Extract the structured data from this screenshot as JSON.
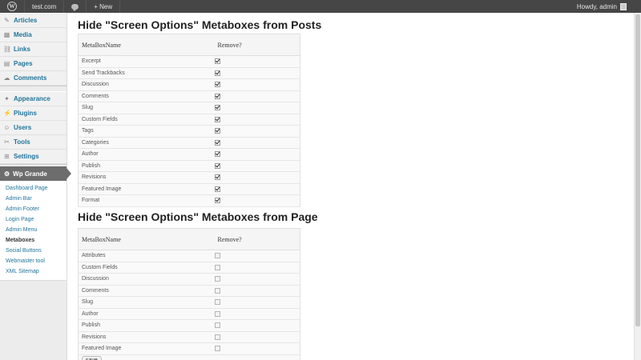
{
  "adminbar": {
    "logo": "W",
    "site": "test.com",
    "new_label": "+ New",
    "greeting": "Howdy, admin"
  },
  "sidebar": {
    "group1": [
      {
        "label": "Articles",
        "icon": "pin-icon",
        "glyph": "✎"
      },
      {
        "label": "Media",
        "icon": "media-icon",
        "glyph": "▦"
      },
      {
        "label": "Links",
        "icon": "link-icon",
        "glyph": "⛓"
      },
      {
        "label": "Pages",
        "icon": "pages-icon",
        "glyph": "▤"
      },
      {
        "label": "Comments",
        "icon": "comments-icon",
        "glyph": "☁"
      }
    ],
    "group2": [
      {
        "label": "Appearance",
        "icon": "appearance-icon",
        "glyph": "✦"
      },
      {
        "label": "Plugins",
        "icon": "plugins-icon",
        "glyph": "⚡"
      },
      {
        "label": "Users",
        "icon": "users-icon",
        "glyph": "☺"
      },
      {
        "label": "Tools",
        "icon": "tools-icon",
        "glyph": "✂"
      },
      {
        "label": "Settings",
        "icon": "settings-icon",
        "glyph": "⊞"
      }
    ],
    "current": {
      "label": "Wp Grande",
      "icon": "gear-icon"
    },
    "submenu": [
      "Dashboard Page",
      "Admin Bar",
      "Admin Footer",
      "Login Page",
      "Admin Menu",
      "Metaboxes",
      "Social Buttons",
      "Webmaster tool",
      "XML Sitemap"
    ],
    "submenu_current": "Metaboxes"
  },
  "posts": {
    "heading": "Hide \"Screen Options\" Metaboxes from Posts",
    "col_name": "MetaBoxName",
    "col_remove": "Remove?",
    "rows": [
      {
        "name": "Excerpt",
        "checked": true
      },
      {
        "name": "Send Trackbacks",
        "checked": true
      },
      {
        "name": "Discussion",
        "checked": true
      },
      {
        "name": "Comments",
        "checked": true
      },
      {
        "name": "Slug",
        "checked": true
      },
      {
        "name": "Custom Fields",
        "checked": true
      },
      {
        "name": "Tags",
        "checked": true
      },
      {
        "name": "Categories",
        "checked": true
      },
      {
        "name": "Author",
        "checked": true
      },
      {
        "name": "Publish",
        "checked": true
      },
      {
        "name": "Revisions",
        "checked": true
      },
      {
        "name": "Featured Image",
        "checked": true
      },
      {
        "name": "Format",
        "checked": true
      }
    ]
  },
  "pages": {
    "heading": "Hide \"Screen Options\" Metaboxes from Page",
    "col_name": "MetaBoxName",
    "col_remove": "Remove?",
    "rows": [
      {
        "name": "Attributes",
        "checked": false
      },
      {
        "name": "Custom Fields",
        "checked": false
      },
      {
        "name": "Discussion",
        "checked": false
      },
      {
        "name": "Comments",
        "checked": false
      },
      {
        "name": "Slug",
        "checked": false
      },
      {
        "name": "Author",
        "checked": false
      },
      {
        "name": "Publish",
        "checked": false
      },
      {
        "name": "Revisions",
        "checked": false
      },
      {
        "name": "Featured Image",
        "checked": false
      }
    ],
    "save_label": "save"
  }
}
